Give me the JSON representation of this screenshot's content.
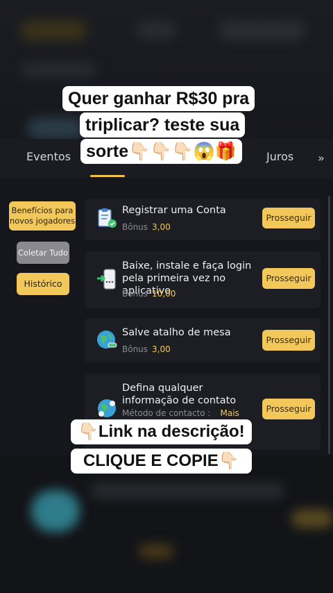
{
  "overlay_top": {
    "line1": "Quer ganhar R$30 pra",
    "line2": "triplicar? teste sua",
    "line3": "sorte👇🏻👇🏻👇🏻😱🎁"
  },
  "tabs": {
    "left": "Eventos",
    "right": "Juros",
    "more": "»"
  },
  "sidebar": {
    "beneficios": "Benefícios para novos jogadores",
    "coletar": "Coletar Tudo",
    "historico": "Histórico"
  },
  "tasks": [
    {
      "title": "Registrar uma Conta",
      "bonus_label": "Bônus",
      "bonus_value": "3,00",
      "button": "Prosseguir",
      "icon": "clipboard-check-icon"
    },
    {
      "title": "Baixe, instale e faça login pela primeira vez no aplicativo",
      "bonus_label": "Bônus",
      "bonus_value": "10,00",
      "button": "Prosseguir",
      "icon": "phone-download-icon"
    },
    {
      "title": "Salve atalho de mesa",
      "bonus_label": "Bônus",
      "bonus_value": "3,00",
      "button": "Prosseguir",
      "icon": "globe-link-icon"
    },
    {
      "title": "Defina qualquer informação de contato",
      "bonus_label": "Método de contacto :",
      "bonus_value": "Mais",
      "button": "Prosseguir",
      "icon": "globe-contact-icon"
    }
  ],
  "overlay_bottom": {
    "line1": "👇🏻Link na descrição!",
    "line2": "CLIQUE E COPIE👇🏻"
  },
  "colors": {
    "accent": "#f3c85a",
    "background": "#16171c",
    "card": "#1d1e24"
  }
}
